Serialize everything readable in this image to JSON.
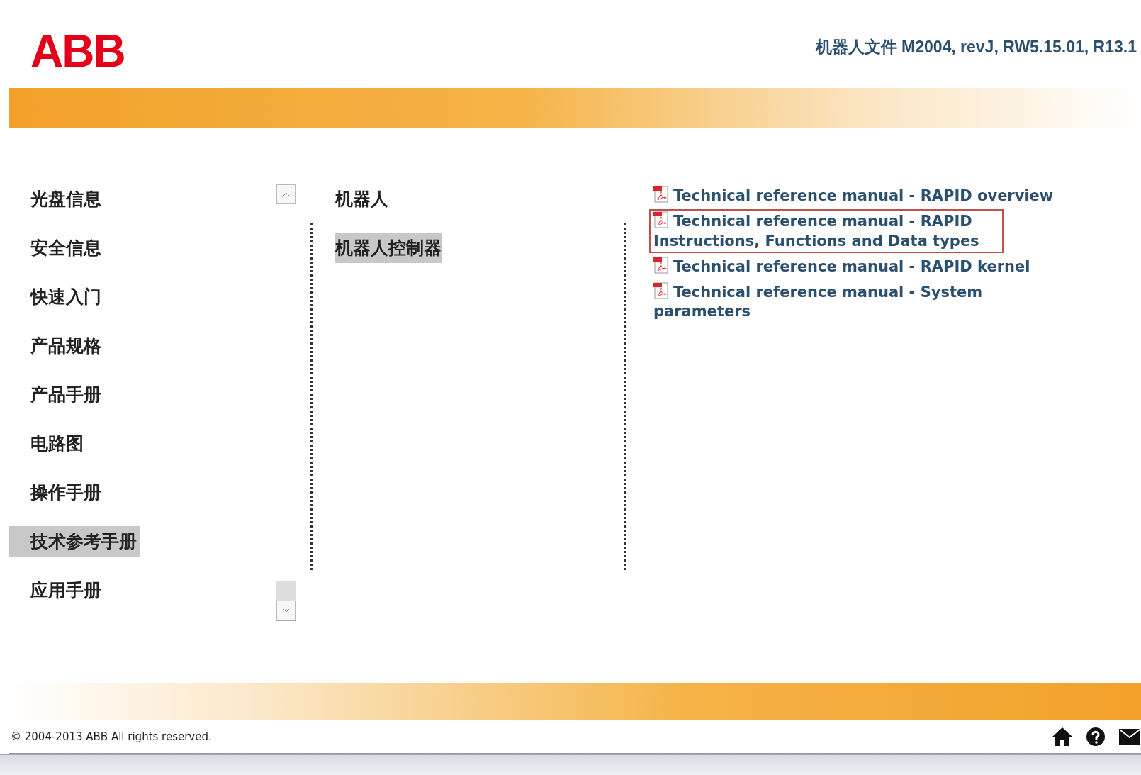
{
  "header": {
    "logo": "ABB",
    "title": "机器人文件 M2004, revJ, RW5.15.01, R13.1"
  },
  "nav": [
    {
      "label": "光盘信息",
      "selected": false
    },
    {
      "label": "安全信息",
      "selected": false
    },
    {
      "label": "快速入门",
      "selected": false
    },
    {
      "label": "产品规格",
      "selected": false
    },
    {
      "label": "产品手册",
      "selected": false
    },
    {
      "label": "电路图",
      "selected": false
    },
    {
      "label": "操作手册",
      "selected": false
    },
    {
      "label": "技术参考手册",
      "selected": true
    },
    {
      "label": "应用手册",
      "selected": false
    }
  ],
  "categories": [
    {
      "label": "机器人",
      "selected": false
    },
    {
      "label": "机器人控制器",
      "selected": true
    }
  ],
  "documents": [
    {
      "label": "Technical reference manual - RAPID overview",
      "highlighted": false
    },
    {
      "label": "Technical reference manual - RAPID Instructions, Functions and Data types",
      "highlighted": true
    },
    {
      "label": "Technical reference manual - RAPID kernel",
      "highlighted": false
    },
    {
      "label": "Technical reference manual - System parameters",
      "highlighted": false
    }
  ],
  "footer": {
    "copyright": "© 2004-2013 ABB All rights reserved."
  }
}
